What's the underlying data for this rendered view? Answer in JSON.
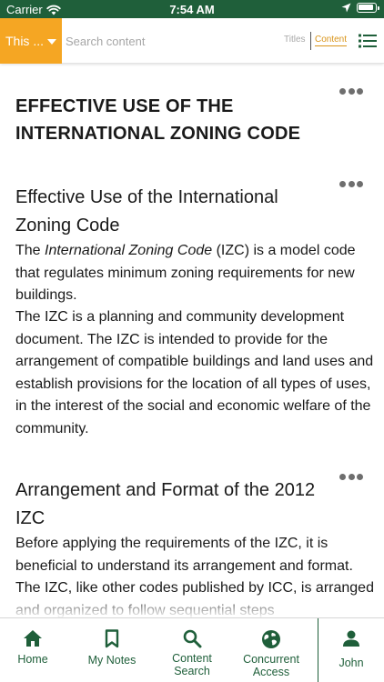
{
  "status_bar": {
    "carrier": "Carrier",
    "time": "7:54 AM"
  },
  "search": {
    "scope_label": "This ...",
    "placeholder": "Search content",
    "mode_titles": "Titles",
    "mode_content": "Content",
    "active_mode": "Content"
  },
  "content": {
    "main_title": "EFFECTIVE USE OF THE INTERNATIONAL ZONING CODE",
    "section1": {
      "heading": "Effective Use of the International Zoning Code",
      "p1_prefix": "The ",
      "p1_italic": "International Zoning Code",
      "p1_suffix": " (IZC) is a model code that regulates minimum zoning requirements for new buildings.",
      "p2": "The IZC is a planning and community development document. The IZC is intended to provide for the arrangement of compatible buildings and land uses and establish provisions for the location of all types of uses, in the interest of the social and economic welfare of the community."
    },
    "section2": {
      "heading": "Arrangement and Format of the 2012 IZC",
      "p1": "Before applying the requirements of the IZC, it is beneficial to understand its arrangement and format. The IZC, like other codes published by ICC, is arranged and organized to follow sequential steps"
    }
  },
  "tabs": [
    {
      "label": "Home",
      "icon": "home-icon"
    },
    {
      "label": "My Notes",
      "icon": "bookmark-icon"
    },
    {
      "label": "Content Search",
      "icon": "search-icon"
    },
    {
      "label": "Concurrent Access",
      "icon": "globe-icon"
    },
    {
      "label": "John",
      "icon": "user-icon"
    }
  ],
  "colors": {
    "brand_green": "#1f5f3a",
    "accent_orange": "#f5a623",
    "active_mode": "#d9941a"
  }
}
